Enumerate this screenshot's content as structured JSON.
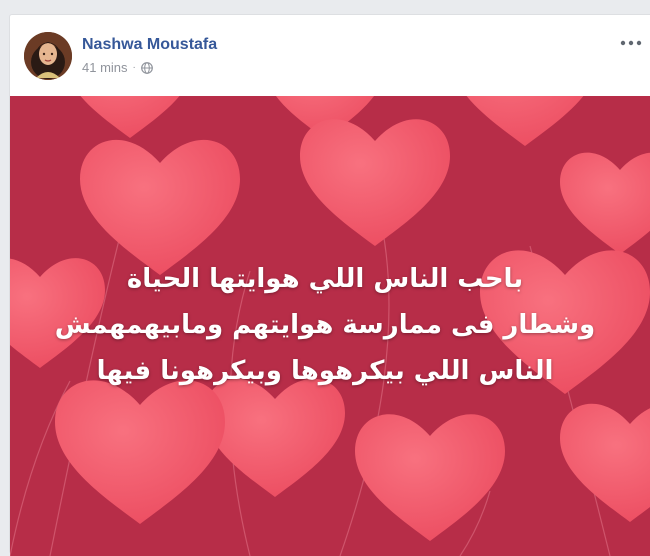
{
  "post": {
    "author_name": "Nashwa Moustafa",
    "timestamp": "41 mins",
    "separator": "·",
    "privacy_icon": "globe-icon",
    "more_icon": "more-horizontal-icon",
    "text_lines": [
      "باحب الناس اللي هوايتها الحياة",
      "وشطار فى ممارسة هوايتهم ومابيهمهمش",
      "الناس اللي بيكرهوها وبيكرهونا فيها"
    ]
  },
  "colors": {
    "author_link": "#365899",
    "meta_text": "#90949c",
    "image_background": "#b72d48",
    "heart": "#f05a6a",
    "text": "#ffffff"
  }
}
